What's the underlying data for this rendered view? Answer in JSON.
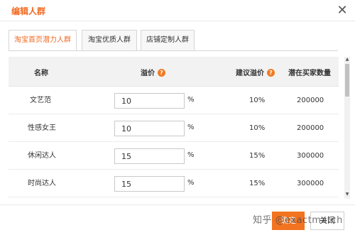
{
  "dialog": {
    "title": "编辑人群",
    "close_label": "✕"
  },
  "tabs": [
    {
      "label": "淘宝首页潜力人群",
      "active": true
    },
    {
      "label": "淘宝优质人群",
      "active": false
    },
    {
      "label": "店铺定制人群",
      "active": false
    }
  ],
  "table": {
    "headers": {
      "name": "名称",
      "premium": "溢价",
      "suggested": "建议溢价",
      "buyers": "潜在买家数量"
    },
    "help_icon": "?",
    "unit": "%",
    "rows": [
      {
        "name": "文艺范",
        "premium": "10",
        "suggested": "10%",
        "buyers": "200000"
      },
      {
        "name": "性感女王",
        "premium": "10",
        "suggested": "10%",
        "buyers": "200000"
      },
      {
        "name": "休闲达人",
        "premium": "15",
        "suggested": "15%",
        "buyers": "300000"
      },
      {
        "name": "时尚达人",
        "premium": "15",
        "suggested": "15%",
        "buyers": "300000"
      }
    ]
  },
  "footer": {
    "ok_label": "确定",
    "cancel_label": "关闭",
    "watermark": "知乎 @exactmatch"
  },
  "colors": {
    "accent": "#f06a23",
    "primary_button": "#f27420",
    "header_bg": "#f2f2f2"
  }
}
